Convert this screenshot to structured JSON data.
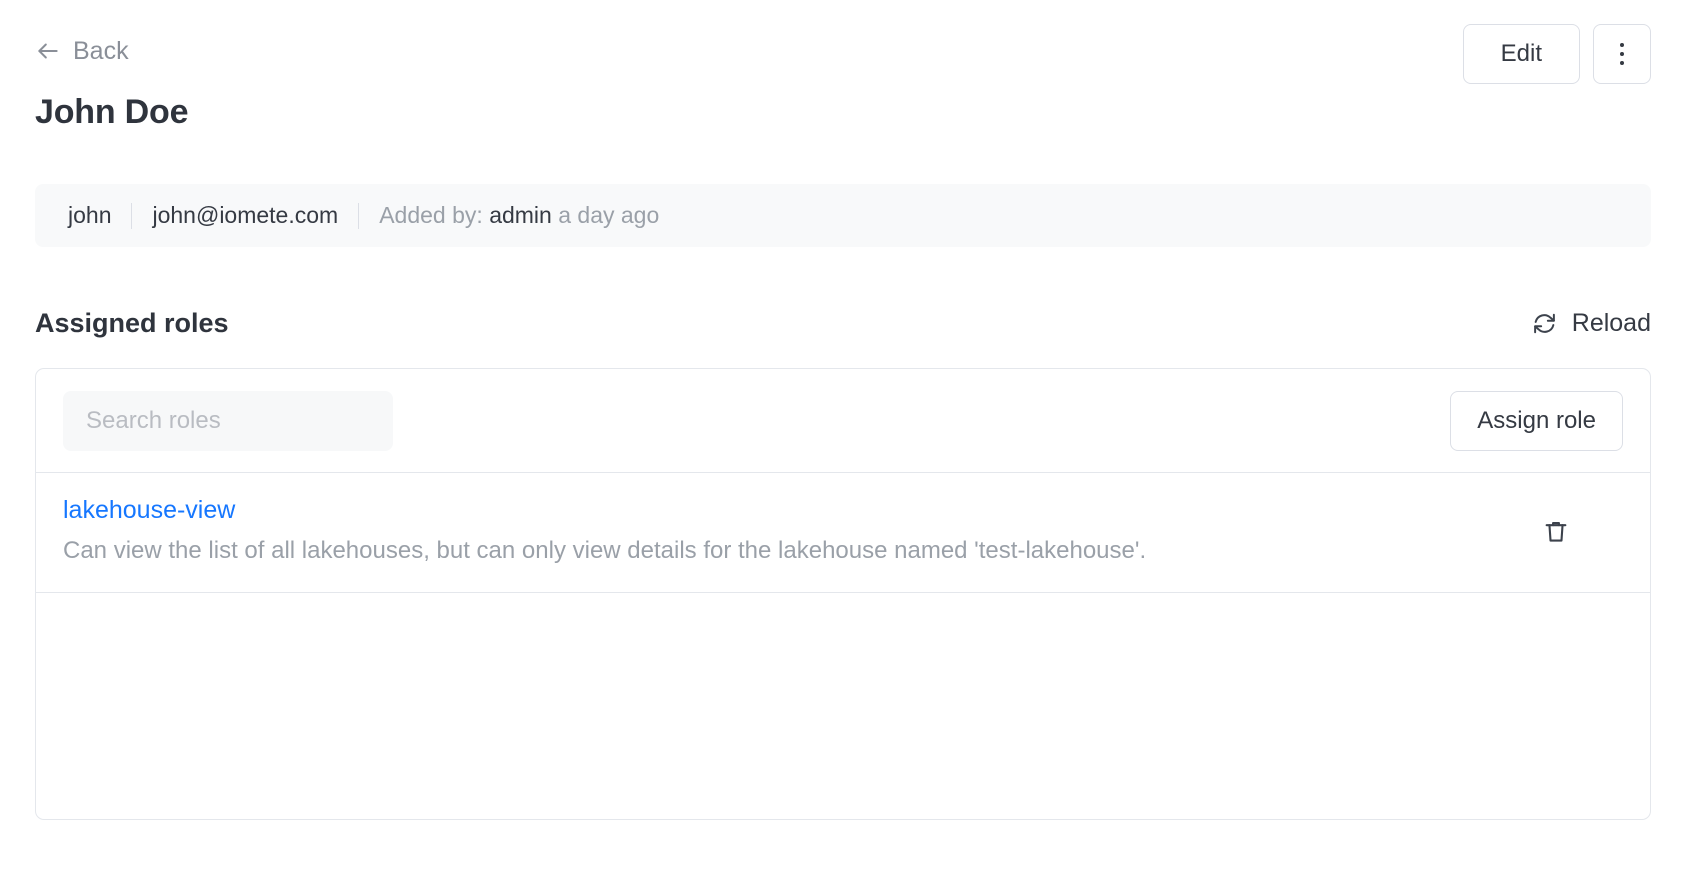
{
  "topbar": {
    "back_label": "Back",
    "back_icon": "arrow-left-icon",
    "edit_label": "Edit",
    "more_icon": "vertical-ellipsis-icon"
  },
  "page_title": "John Doe",
  "meta": {
    "username": "john",
    "email": "john@iomete.com",
    "added_by_prefix": "Added by:",
    "added_by_user": "admin",
    "added_time": "a day ago"
  },
  "section": {
    "title": "Assigned roles",
    "reload_label": "Reload",
    "reload_icon": "refresh-icon"
  },
  "roles_panel": {
    "search_placeholder": "Search roles",
    "search_value": "",
    "assign_label": "Assign role",
    "delete_icon": "trash-icon",
    "rows": [
      {
        "name": "lakehouse-view",
        "description": "Can view the list of all lakehouses, but can only view details for the lakehouse named 'test-lakehouse'."
      }
    ]
  },
  "colors": {
    "link": "#1677ff",
    "text": "#353a43",
    "muted": "#9aa0a8",
    "border": "#e4e7ec",
    "panel_bg": "#f8f9fa"
  }
}
